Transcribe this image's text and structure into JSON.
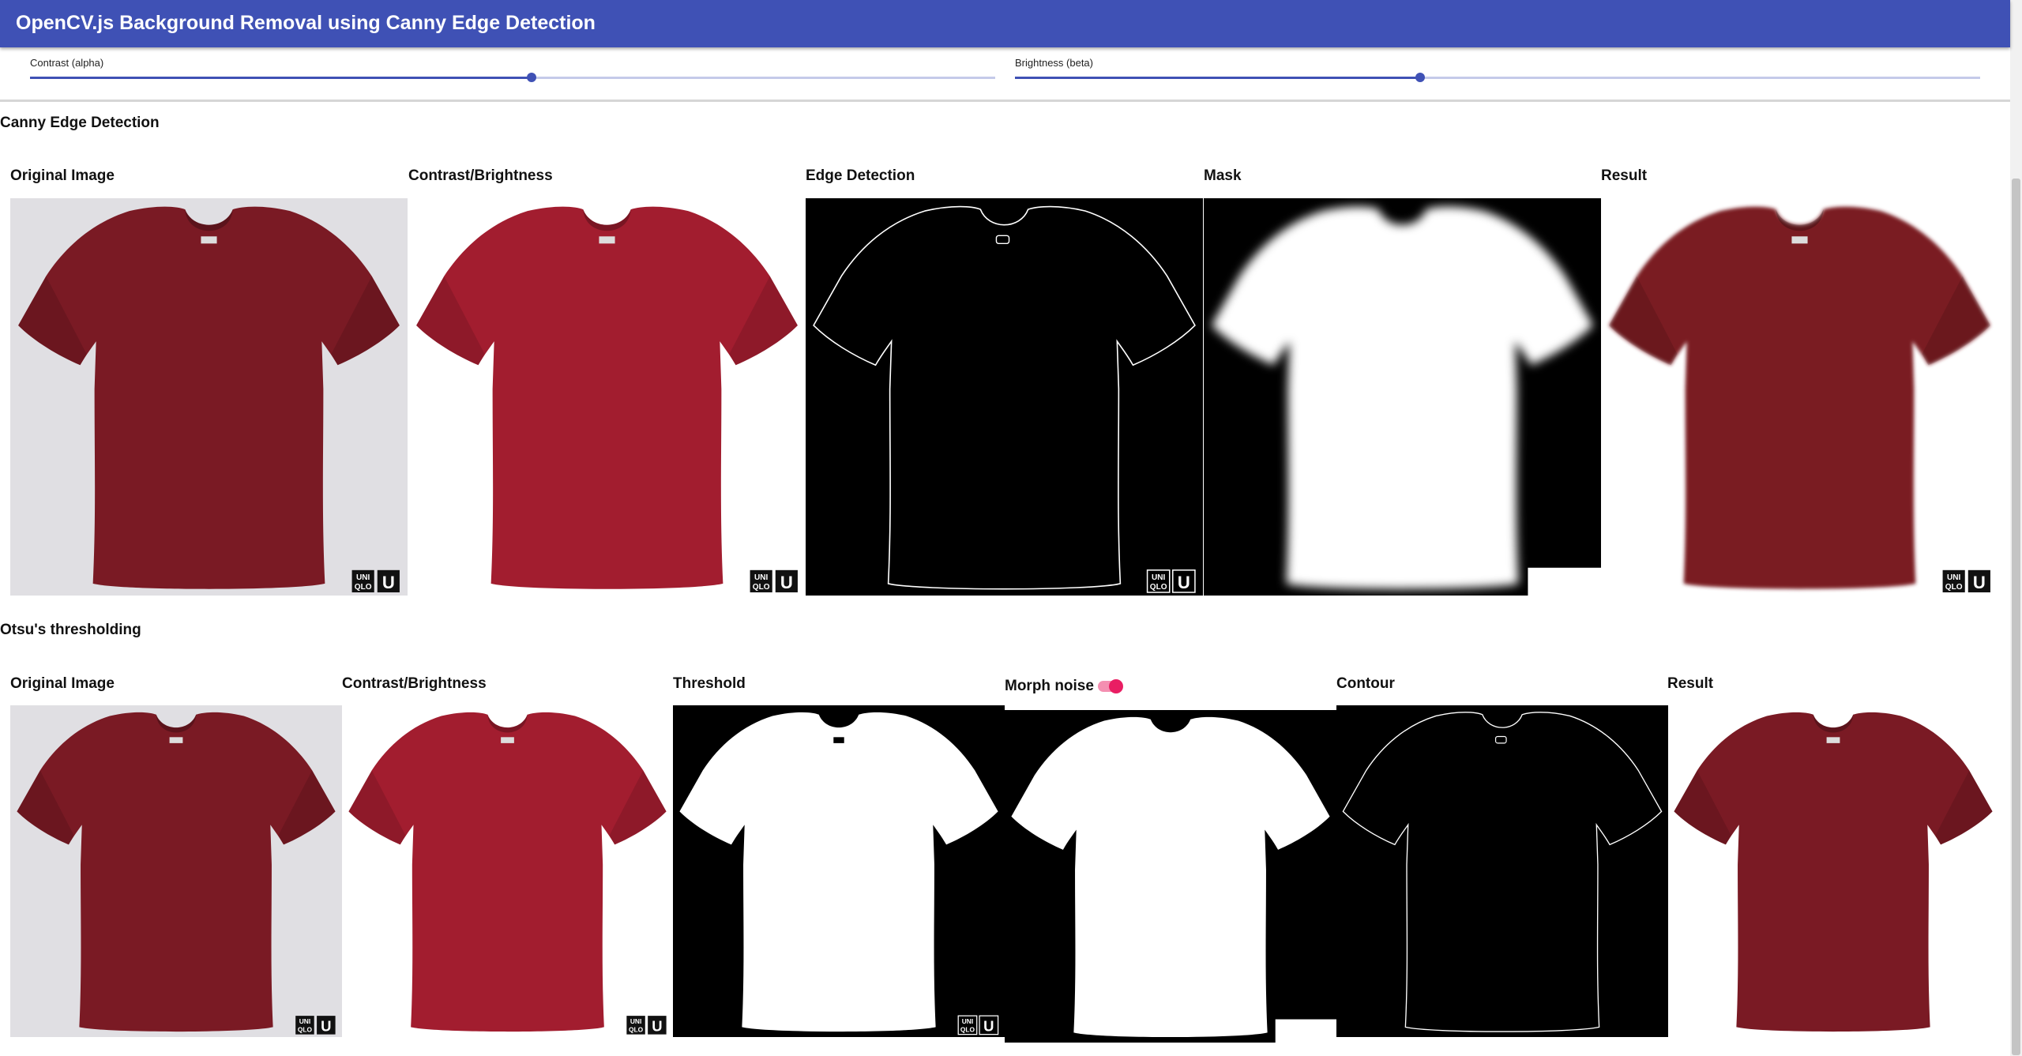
{
  "header": {
    "title": "OpenCV.js Background Removal using Canny Edge Detection"
  },
  "controls": {
    "contrast": {
      "label": "Contrast (alpha)",
      "value_fraction": 0.52
    },
    "brightness": {
      "label": "Brightness (beta)",
      "value_fraction": 0.42
    }
  },
  "canny": {
    "title": "Canny Edge Detection",
    "panels": [
      "Original Image",
      "Contrast/Brightness",
      "Edge Detection",
      "Mask",
      "Result"
    ]
  },
  "otsu": {
    "title": "Otsu's thresholding",
    "panels": [
      "Original Image",
      "Contrast/Brightness",
      "Threshold",
      "Morph noise",
      "Contour",
      "Result"
    ],
    "morph_noise_toggle": true
  },
  "brand": {
    "line1": "UNI",
    "line2": "QLO",
    "mark": "U"
  },
  "colors": {
    "appbar": "#3f51b5",
    "shirt_original": "#7a1a24",
    "shirt_contrast": "#a21d2f",
    "toggle": "#e91e63",
    "photo_background": "#e0dfe3"
  }
}
